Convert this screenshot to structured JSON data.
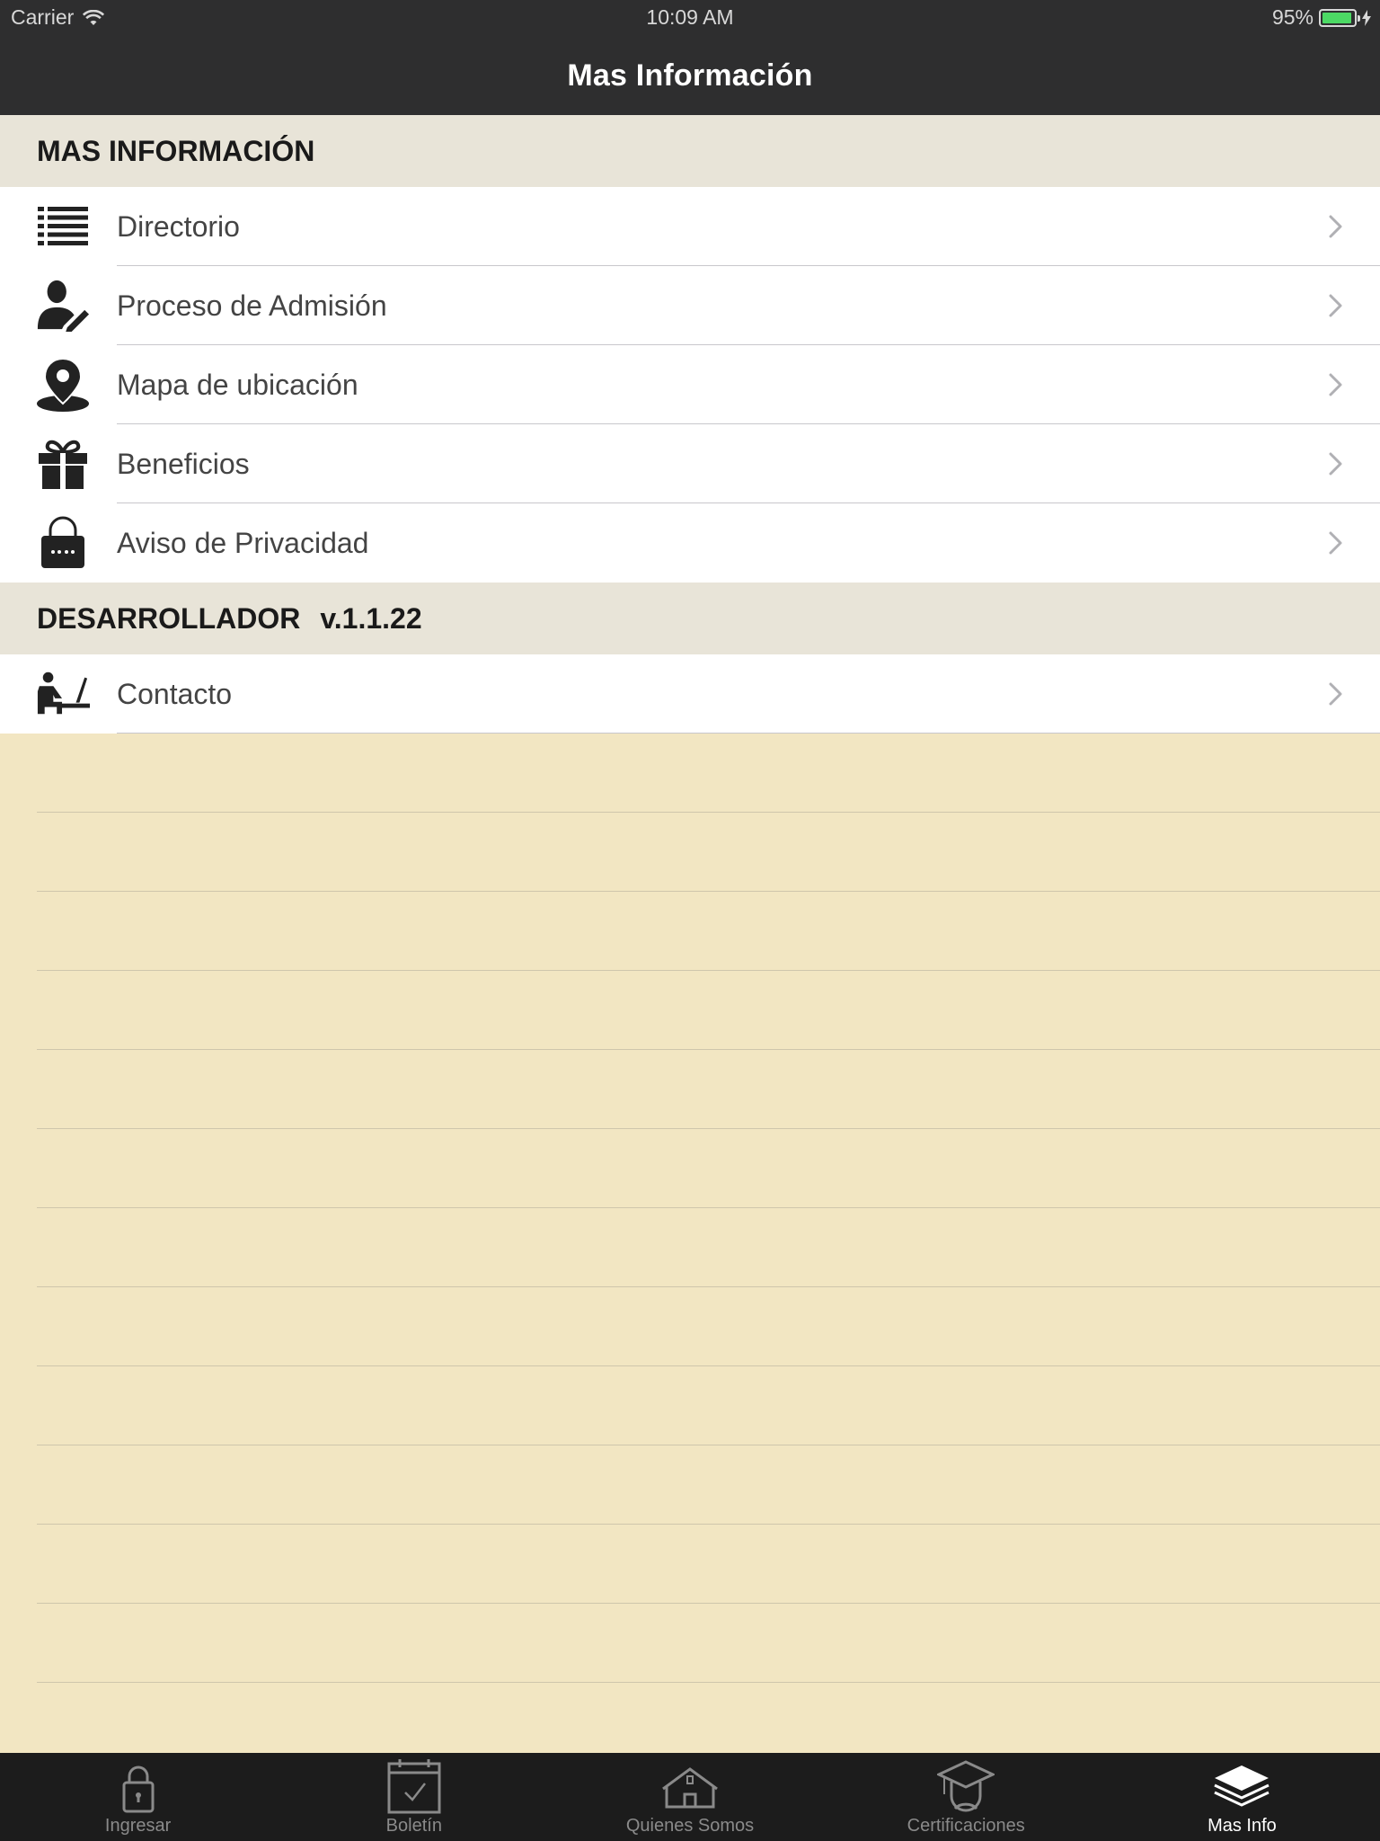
{
  "status_bar": {
    "carrier": "Carrier",
    "time": "10:09 AM",
    "battery": "95%",
    "battery_level": 0.95
  },
  "nav": {
    "title": "Mas Información"
  },
  "section_info": {
    "title": "MAS INFORMACIÓN"
  },
  "menu": [
    {
      "label": "Directorio",
      "icon": "list-icon"
    },
    {
      "label": "Proceso de Admisión",
      "icon": "person-edit-icon"
    },
    {
      "label": "Mapa de ubicación",
      "icon": "map-pin-icon"
    },
    {
      "label": "Beneficios",
      "icon": "gift-icon"
    },
    {
      "label": "Aviso de Privacidad",
      "icon": "lock-icon"
    }
  ],
  "section_dev": {
    "title": "DESARROLLADOR",
    "version": "v.1.1.22"
  },
  "dev_menu": [
    {
      "label": "Contacto",
      "icon": "person-desk-icon"
    }
  ],
  "tabs": [
    {
      "label": "Ingresar",
      "icon": "lock-icon",
      "active": false
    },
    {
      "label": "Boletín",
      "icon": "calendar-check-icon",
      "active": false
    },
    {
      "label": "Quienes Somos",
      "icon": "school-building-icon",
      "active": false
    },
    {
      "label": "Certificaciones",
      "icon": "graduate-icon",
      "active": false
    },
    {
      "label": "Mas Info",
      "icon": "layers-icon",
      "active": true
    }
  ],
  "colors": {
    "bar_bg": "#2e2e2f",
    "tabbar_bg": "#1c1c1c",
    "page_bg": "#f2e6c2",
    "header_bg": "#e8e4d8",
    "battery_green": "#4cd964"
  }
}
